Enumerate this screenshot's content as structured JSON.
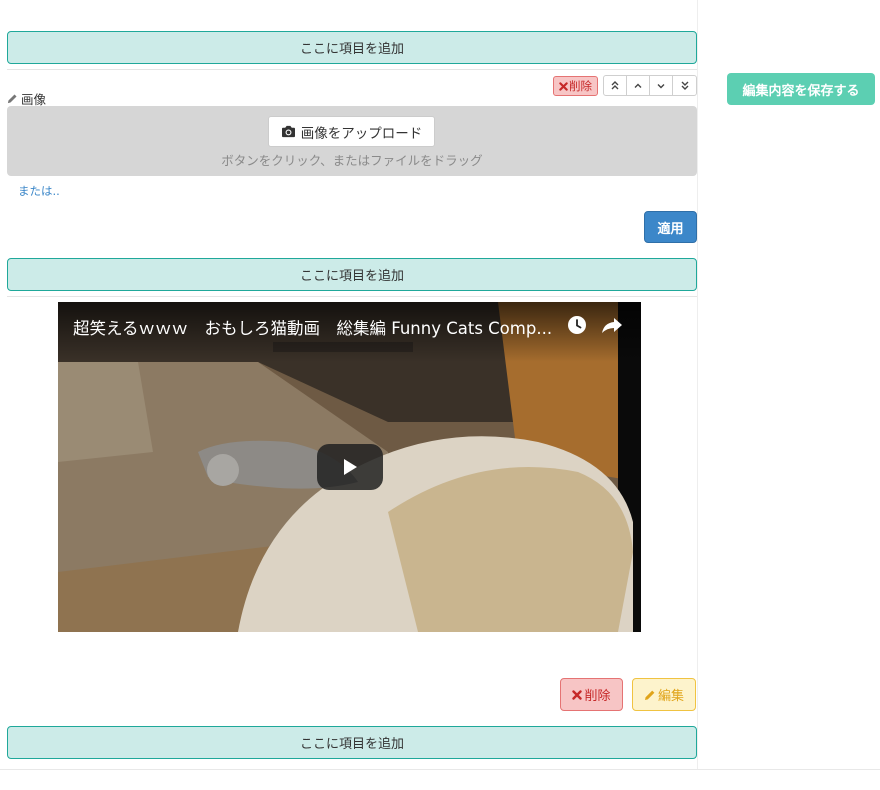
{
  "editor": {
    "add_item_label": "ここに項目を追加",
    "image_block": {
      "label": "画像",
      "delete_label": "削除",
      "upload_button_label": "画像をアップロード",
      "upload_hint": "ボタンをクリック、またはファイルをドラッグ",
      "or_link": "または..",
      "apply_label": "適用",
      "move_icons": [
        "double-chevron-up-icon",
        "chevron-up-icon",
        "chevron-down-icon",
        "double-chevron-down-icon"
      ]
    },
    "video_block": {
      "title": "超笑えるｗｗｗ　おもしろ猫動画　総集編 Funny Cats Comp...",
      "delete_label": "削除",
      "edit_label": "編集"
    }
  },
  "sidebar": {
    "save_label": "編集内容を保存する"
  },
  "colors": {
    "add_bar_bg": "#ccebe8",
    "add_bar_border": "#1fa89a",
    "save_button": "#5ccfb2",
    "apply_button": "#3c87c9",
    "delete_bg": "#f7c5c5",
    "edit_bg": "#fdf3cc"
  }
}
